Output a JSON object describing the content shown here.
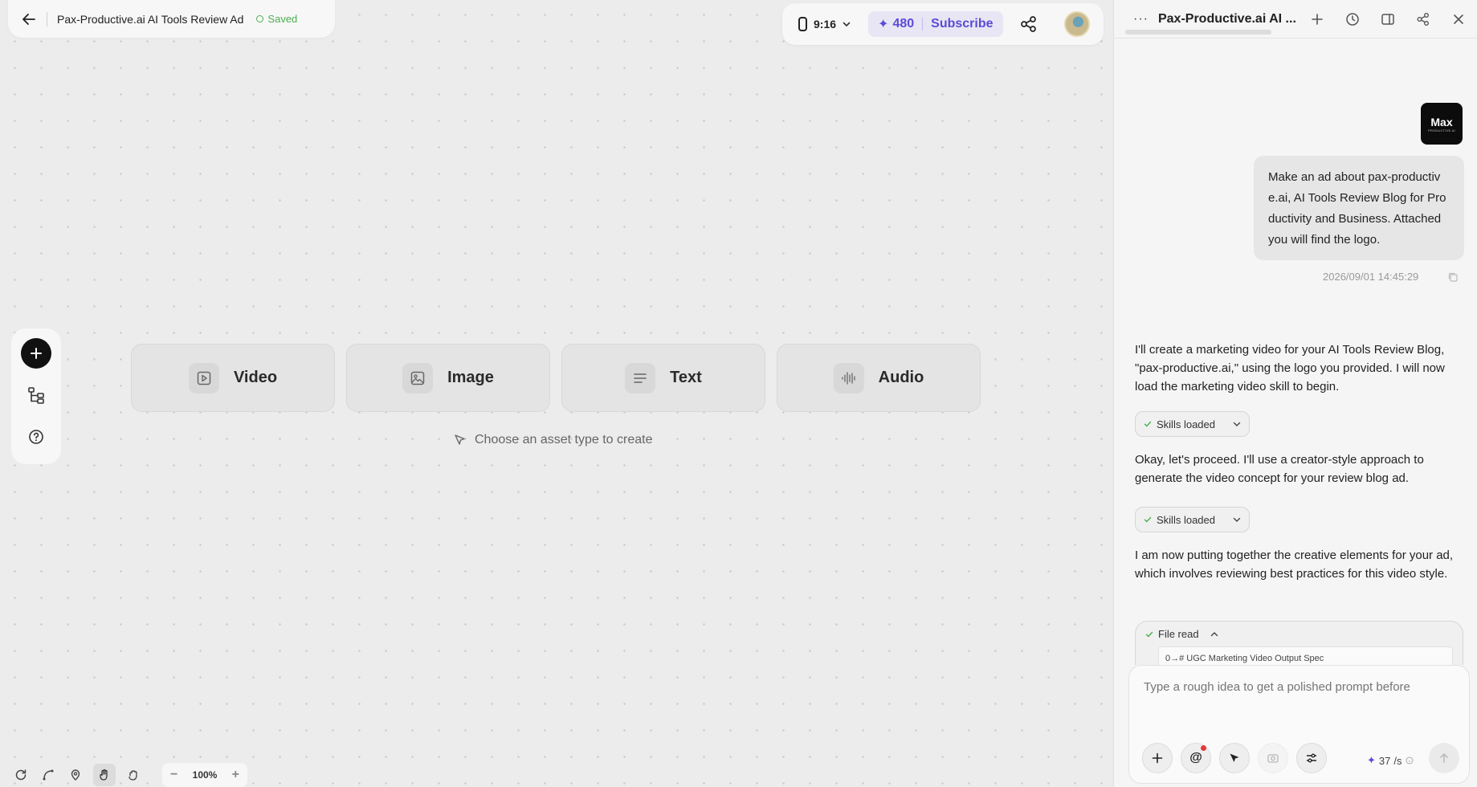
{
  "header": {
    "doc_title": "Pax-Productive.ai AI Tools Review Ad",
    "saved_label": "Saved",
    "aspect_ratio": "9:16",
    "credits": "480",
    "subscribe_label": "Subscribe",
    "accent_color": "#5b4bd6"
  },
  "canvas": {
    "assets": [
      {
        "label": "Video",
        "icon": "video-play-icon"
      },
      {
        "label": "Image",
        "icon": "image-icon"
      },
      {
        "label": "Text",
        "icon": "text-lines-icon"
      },
      {
        "label": "Audio",
        "icon": "audio-wave-icon"
      }
    ],
    "hint": "Choose an asset type to create",
    "zoom": "100%"
  },
  "panel": {
    "title": "Pax-Productive.ai AI ...",
    "logo_text": "Max",
    "logo_sub": "PRODUCTIVE.AI",
    "user_message": "Make an ad about pax-productive.ai, AI Tools Review Blog for Productivity and Business. Attached you will find the logo.",
    "timestamp": "2026/09/01 14:45:29",
    "ai_messages": [
      "I'll create a marketing video for your AI Tools Review Blog, \"pax-productive.ai,\" using the logo you provided. I will now load the marketing video skill to begin.",
      "Okay, let's proceed. I'll use a creator-style approach to generate the video concept for your review blog ad.",
      "I am now putting together the creative elements for your ad, which involves reviewing best practices for this video style."
    ],
    "skills_chip": "Skills loaded",
    "file_read_label": "File read",
    "file_read_preview": "0→# UGC Marketing Video Output Spec",
    "composer_placeholder": "Type a rough idea to get a polished prompt before",
    "cost_value": "37",
    "cost_unit": "/s"
  }
}
